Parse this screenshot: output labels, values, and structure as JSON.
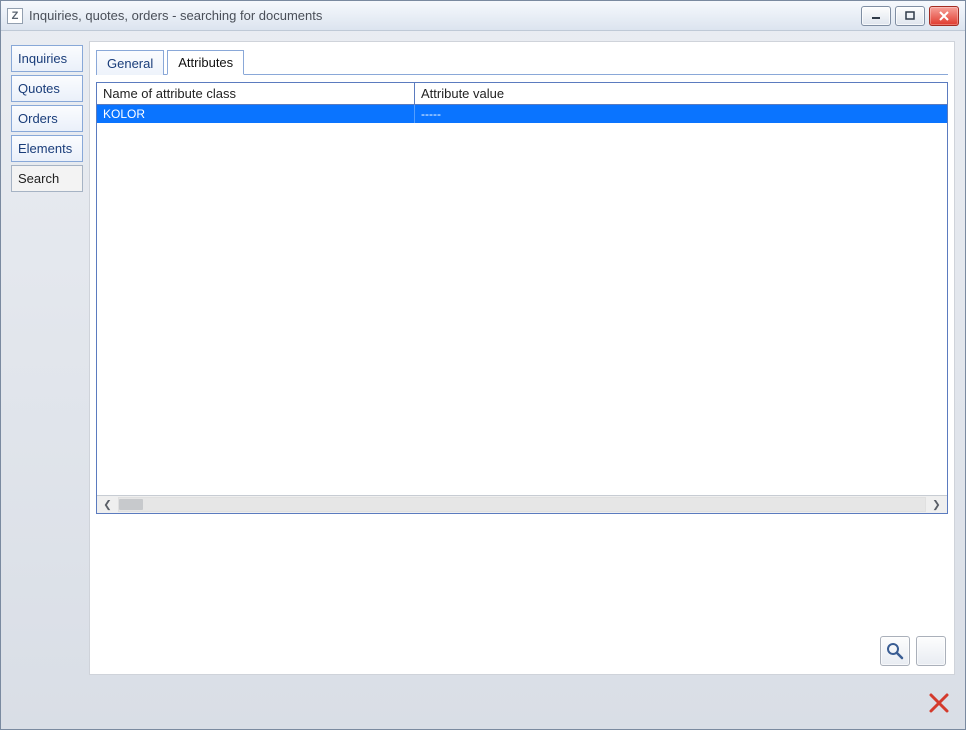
{
  "window": {
    "title": "Inquiries, quotes, orders - searching for documents",
    "icon_label": "Z"
  },
  "side_tabs": [
    {
      "label": "Inquiries",
      "active": false
    },
    {
      "label": "Quotes",
      "active": false
    },
    {
      "label": "Orders",
      "active": false
    },
    {
      "label": "Elements",
      "active": false
    },
    {
      "label": "Search",
      "active": true
    }
  ],
  "top_tabs": [
    {
      "label": "General",
      "active": false
    },
    {
      "label": "Attributes",
      "active": true
    }
  ],
  "grid": {
    "columns": {
      "name": "Name of attribute class",
      "value": "Attribute value"
    },
    "rows": [
      {
        "name": "KOLOR",
        "value": "-----",
        "selected": true
      }
    ]
  }
}
